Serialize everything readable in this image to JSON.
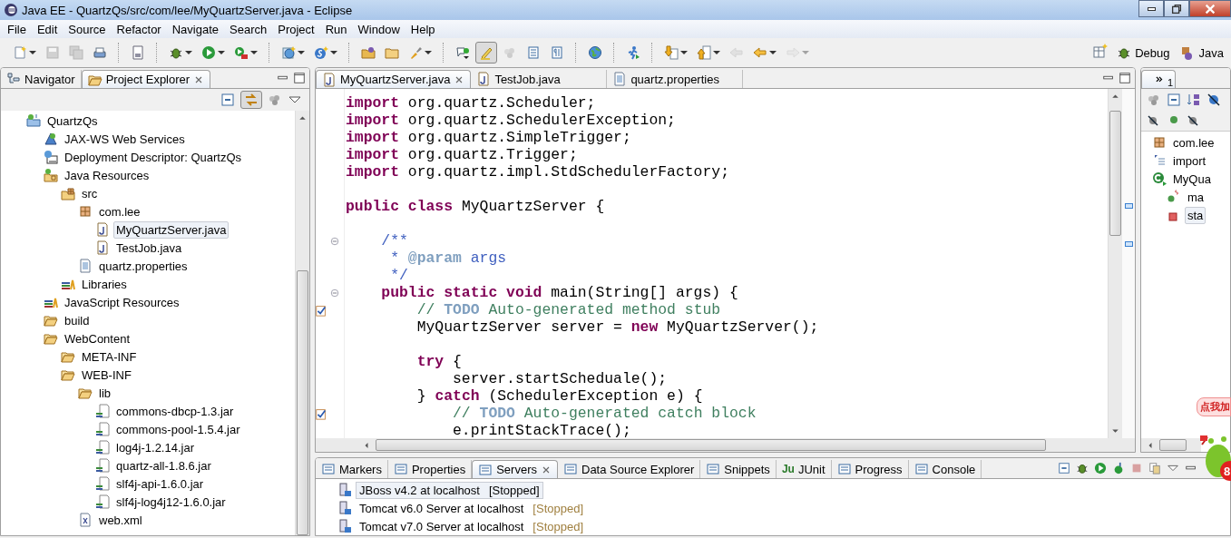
{
  "window": {
    "title": "Java EE - QuartzQs/src/com/lee/MyQuartzServer.java - Eclipse"
  },
  "menu": [
    "File",
    "Edit",
    "Source",
    "Refactor",
    "Navigate",
    "Search",
    "Project",
    "Run",
    "Window",
    "Help"
  ],
  "toolbar": [
    {
      "kind": "button",
      "dropdown": true,
      "disabled": false,
      "pressed": false
    },
    {
      "kind": "button",
      "dropdown": false,
      "disabled": true,
      "pressed": false
    },
    {
      "kind": "button",
      "dropdown": false,
      "disabled": true,
      "pressed": false
    },
    {
      "kind": "button",
      "dropdown": false,
      "disabled": false,
      "pressed": false
    },
    {
      "kind": "separator"
    },
    {
      "kind": "button",
      "dropdown": false,
      "disabled": false,
      "pressed": false
    },
    {
      "kind": "separator"
    },
    {
      "kind": "button",
      "dropdown": true,
      "disabled": false,
      "pressed": false
    },
    {
      "kind": "button",
      "dropdown": true,
      "disabled": false,
      "pressed": false
    },
    {
      "kind": "button",
      "dropdown": true,
      "disabled": false,
      "pressed": false
    },
    {
      "kind": "separator"
    },
    {
      "kind": "button",
      "dropdown": true,
      "disabled": false,
      "pressed": false
    },
    {
      "kind": "button",
      "dropdown": true,
      "disabled": false,
      "pressed": false
    },
    {
      "kind": "separator"
    },
    {
      "kind": "button",
      "dropdown": false,
      "disabled": false,
      "pressed": false
    },
    {
      "kind": "button",
      "dropdown": false,
      "disabled": false,
      "pressed": false
    },
    {
      "kind": "button",
      "dropdown": true,
      "disabled": false,
      "pressed": false
    },
    {
      "kind": "separator"
    },
    {
      "kind": "button",
      "dropdown": false,
      "disabled": false,
      "pressed": false
    },
    {
      "kind": "button",
      "dropdown": false,
      "disabled": false,
      "pressed": true
    },
    {
      "kind": "button",
      "dropdown": false,
      "disabled": true,
      "pressed": false
    },
    {
      "kind": "button",
      "dropdown": false,
      "disabled": false,
      "pressed": false
    },
    {
      "kind": "button",
      "dropdown": false,
      "disabled": false,
      "pressed": false
    },
    {
      "kind": "separator"
    },
    {
      "kind": "button",
      "dropdown": false,
      "disabled": false,
      "pressed": false
    },
    {
      "kind": "separator"
    },
    {
      "kind": "button",
      "dropdown": false,
      "disabled": false,
      "pressed": false
    },
    {
      "kind": "separator"
    },
    {
      "kind": "button",
      "dropdown": true,
      "disabled": false,
      "pressed": false
    },
    {
      "kind": "button",
      "dropdown": true,
      "disabled": false,
      "pressed": false
    },
    {
      "kind": "button",
      "dropdown": false,
      "disabled": true,
      "pressed": false
    },
    {
      "kind": "button",
      "dropdown": true,
      "disabled": false,
      "pressed": false
    },
    {
      "kind": "button",
      "dropdown": true,
      "disabled": true,
      "pressed": false
    }
  ],
  "perspectives": [
    "Debug",
    "Java"
  ],
  "explorer": {
    "tabs": [
      {
        "label": "Navigator",
        "selected": false
      },
      {
        "label": "Project Explorer",
        "selected": true
      }
    ],
    "tree": [
      {
        "kind": "project",
        "label": "QuartzQs",
        "selected": false,
        "children": [
          {
            "kind": "webservices",
            "label": "JAX-WS Web Services",
            "selected": false
          },
          {
            "kind": "descriptor",
            "label": "Deployment Descriptor: QuartzQs",
            "selected": false
          },
          {
            "kind": "javares",
            "label": "Java Resources",
            "selected": false,
            "children": [
              {
                "kind": "srcfolder",
                "label": "src",
                "selected": false,
                "children": [
                  {
                    "kind": "package",
                    "label": "com.lee",
                    "selected": false,
                    "children": [
                      {
                        "kind": "java",
                        "label": "MyQuartzServer.java",
                        "selected": true
                      },
                      {
                        "kind": "java",
                        "label": "TestJob.java",
                        "selected": false
                      }
                    ]
                  },
                  {
                    "kind": "properties",
                    "label": "quartz.properties",
                    "selected": false
                  }
                ]
              },
              {
                "kind": "library",
                "label": "Libraries",
                "selected": false
              }
            ]
          },
          {
            "kind": "library",
            "label": "JavaScript Resources",
            "selected": false
          },
          {
            "kind": "folder",
            "label": "build",
            "selected": false
          },
          {
            "kind": "folder",
            "label": "WebContent",
            "selected": false,
            "children": [
              {
                "kind": "folder",
                "label": "META-INF",
                "selected": false
              },
              {
                "kind": "folder",
                "label": "WEB-INF",
                "selected": false,
                "children": [
                  {
                    "kind": "folder",
                    "label": "lib",
                    "selected": false,
                    "children": [
                      {
                        "kind": "jar",
                        "label": "commons-dbcp-1.3.jar",
                        "selected": false
                      },
                      {
                        "kind": "jar",
                        "label": "commons-pool-1.5.4.jar",
                        "selected": false
                      },
                      {
                        "kind": "jar",
                        "label": "log4j-1.2.14.jar",
                        "selected": false
                      },
                      {
                        "kind": "jar",
                        "label": "quartz-all-1.8.6.jar",
                        "selected": false
                      },
                      {
                        "kind": "jar",
                        "label": "slf4j-api-1.6.0.jar",
                        "selected": false
                      },
                      {
                        "kind": "jar",
                        "label": "slf4j-log4j12-1.6.0.jar",
                        "selected": false
                      }
                    ]
                  },
                  {
                    "kind": "xml",
                    "label": "web.xml",
                    "selected": false
                  }
                ]
              }
            ]
          }
        ]
      }
    ]
  },
  "editor": {
    "tabs": [
      {
        "kind": "java",
        "label": "MyQuartzServer.java",
        "selected": true
      },
      {
        "kind": "java",
        "label": "TestJob.java",
        "selected": false
      },
      {
        "kind": "properties",
        "label": "quartz.properties",
        "selected": false
      }
    ],
    "lines": [
      {
        "blank_before": false,
        "fold": false,
        "task": false,
        "segments": [
          {
            "kind": "keyword",
            "text": "import"
          },
          {
            "kind": "plain",
            "text": " org.quartz.Scheduler;"
          }
        ]
      },
      {
        "blank_before": false,
        "fold": false,
        "task": false,
        "segments": [
          {
            "kind": "keyword",
            "text": "import"
          },
          {
            "kind": "plain",
            "text": " org.quartz.SchedulerException;"
          }
        ]
      },
      {
        "blank_before": false,
        "fold": false,
        "task": false,
        "segments": [
          {
            "kind": "keyword",
            "text": "import"
          },
          {
            "kind": "plain",
            "text": " org.quartz.SimpleTrigger;"
          }
        ]
      },
      {
        "blank_before": false,
        "fold": false,
        "task": false,
        "segments": [
          {
            "kind": "keyword",
            "text": "import"
          },
          {
            "kind": "plain",
            "text": " org.quartz.Trigger;"
          }
        ]
      },
      {
        "blank_before": false,
        "fold": false,
        "task": false,
        "segments": [
          {
            "kind": "keyword",
            "text": "import"
          },
          {
            "kind": "plain",
            "text": " org.quartz.impl.StdSchedulerFactory;"
          }
        ]
      },
      {
        "blank_before": true,
        "fold": false,
        "task": false,
        "segments": [
          {
            "kind": "keyword",
            "text": "public class"
          },
          {
            "kind": "plain",
            "text": " MyQuartzServer {"
          }
        ]
      },
      {
        "blank_before": true,
        "fold": true,
        "task": false,
        "segments": [
          {
            "kind": "javadoc",
            "text": "    /**"
          }
        ]
      },
      {
        "blank_before": false,
        "fold": false,
        "task": false,
        "segments": [
          {
            "kind": "javadoc",
            "text": "     * "
          },
          {
            "kind": "javadoc_tag",
            "text": "@param"
          },
          {
            "kind": "javadoc",
            "text": " args"
          }
        ]
      },
      {
        "blank_before": false,
        "fold": false,
        "task": false,
        "segments": [
          {
            "kind": "javadoc",
            "text": "     */"
          }
        ]
      },
      {
        "blank_before": false,
        "fold": true,
        "task": false,
        "segments": [
          {
            "kind": "keyword",
            "text": "    public static void"
          },
          {
            "kind": "plain",
            "text": " main(String[] args) {"
          }
        ]
      },
      {
        "blank_before": false,
        "fold": false,
        "task": true,
        "segments": [
          {
            "kind": "comment",
            "text": "        // "
          },
          {
            "kind": "todo",
            "text": "TODO"
          },
          {
            "kind": "comment",
            "text": " Auto-generated method stub"
          }
        ]
      },
      {
        "blank_before": false,
        "fold": false,
        "task": false,
        "segments": [
          {
            "kind": "plain",
            "text": "        MyQuartzServer server = "
          },
          {
            "kind": "keyword",
            "text": "new"
          },
          {
            "kind": "plain",
            "text": " MyQuartzServer();"
          }
        ]
      },
      {
        "blank_before": true,
        "fold": false,
        "task": false,
        "segments": [
          {
            "kind": "keyword",
            "text": "        try"
          },
          {
            "kind": "plain",
            "text": " {"
          }
        ]
      },
      {
        "blank_before": false,
        "fold": false,
        "task": false,
        "segments": [
          {
            "kind": "plain",
            "text": "            server.startScheduale();"
          }
        ]
      },
      {
        "blank_before": false,
        "fold": false,
        "task": false,
        "segments": [
          {
            "kind": "plain",
            "text": "        } "
          },
          {
            "kind": "keyword",
            "text": "catch"
          },
          {
            "kind": "plain",
            "text": " (SchedulerException e) {"
          }
        ]
      },
      {
        "blank_before": false,
        "fold": false,
        "task": true,
        "segments": [
          {
            "kind": "comment",
            "text": "            // "
          },
          {
            "kind": "todo",
            "text": "TODO"
          },
          {
            "kind": "comment",
            "text": " Auto-generated catch block"
          }
        ]
      },
      {
        "blank_before": false,
        "fold": false,
        "task": false,
        "segments": [
          {
            "kind": "plain",
            "text": "            e.printStackTrace();"
          }
        ]
      }
    ]
  },
  "outline": {
    "overflow_count": "1",
    "tree": [
      {
        "kind": "package",
        "label": "com.lee",
        "selected": false
      },
      {
        "kind": "imports",
        "label": "import",
        "selected": false
      },
      {
        "kind": "class",
        "label": "MyQua",
        "selected": false,
        "children": [
          {
            "kind": "static_method",
            "label": "ma",
            "selected": false
          },
          {
            "kind": "private_method",
            "label": "sta",
            "selected": true
          }
        ]
      }
    ]
  },
  "servers_view": {
    "tabs": [
      {
        "label": "Markers",
        "selected": false
      },
      {
        "label": "Properties",
        "selected": false
      },
      {
        "label": "Servers",
        "selected": true
      },
      {
        "label": "Data Source Explorer",
        "selected": false
      },
      {
        "label": "Snippets",
        "selected": false
      },
      {
        "label": "JUnit",
        "icon_text": "Ju",
        "selected": false
      },
      {
        "label": "Progress",
        "selected": false
      },
      {
        "label": "Console",
        "selected": false
      }
    ],
    "servers": [
      {
        "name": "JBoss v4.2 at localhost",
        "status": "[Stopped]",
        "selected": true
      },
      {
        "name": "Tomcat v6.0 Server at localhost",
        "status": "[Stopped]",
        "selected": false
      },
      {
        "name": "Tomcat v7.0 Server at localhost",
        "status": "[Stopped]",
        "selected": false
      }
    ]
  },
  "widget": {
    "bubble": "点我加",
    "badge": "8"
  }
}
